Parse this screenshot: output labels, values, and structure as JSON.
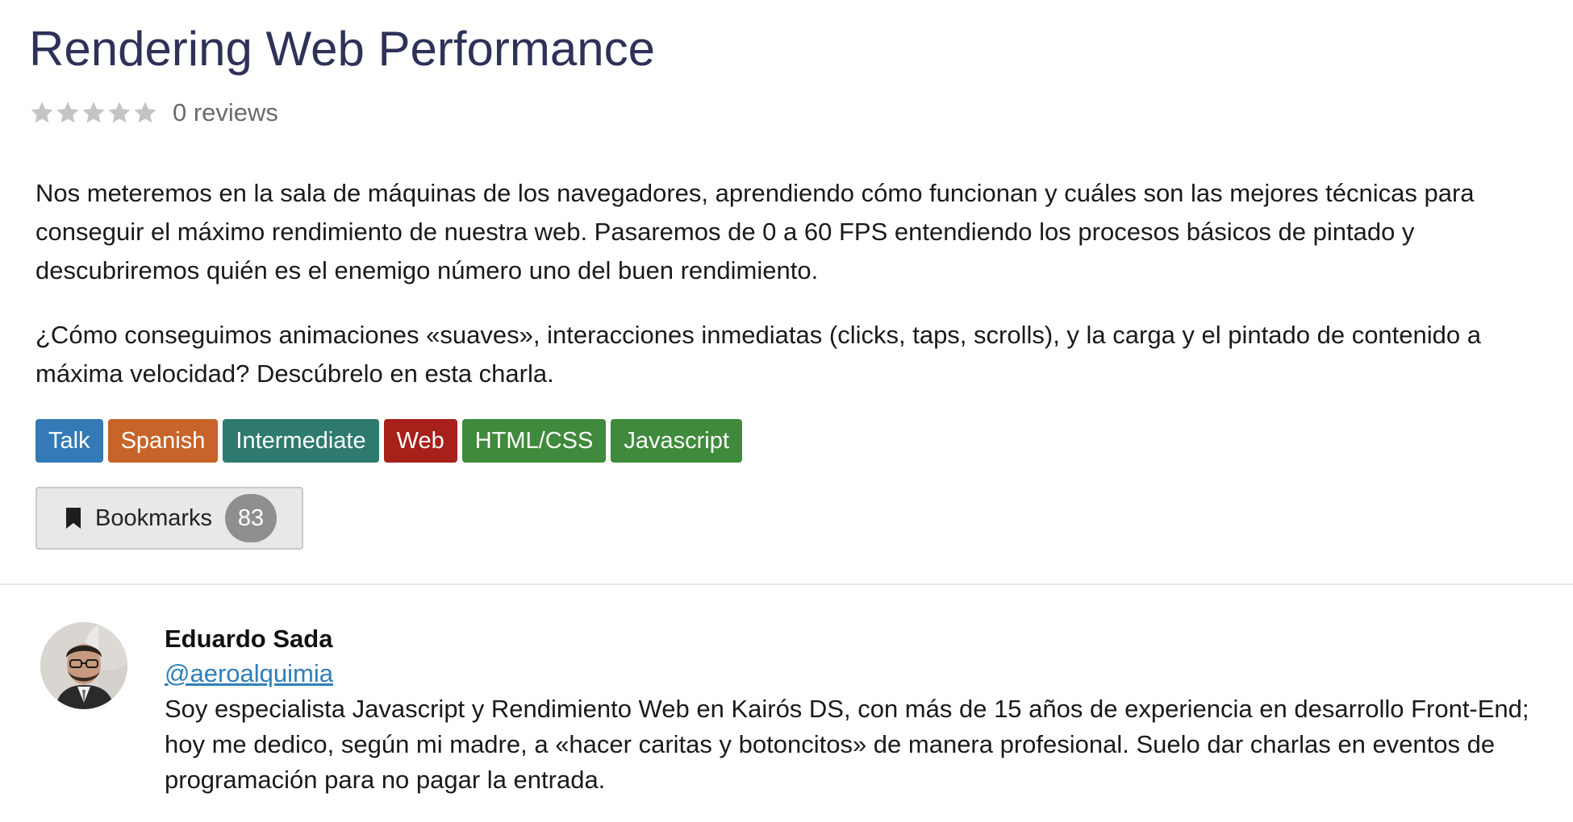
{
  "talk": {
    "title": "Rendering Web Performance",
    "rating": {
      "value": 0,
      "max": 5,
      "reviews_label": "0 reviews"
    },
    "description": [
      "Nos meteremos en la sala de máquinas de los navegadores, aprendiendo cómo funcionan y cuáles son las mejores técnicas para conseguir el máximo rendimiento de nuestra web. Pasaremos de 0 a 60 FPS entendiendo los procesos básicos de pintado y descubriremos quién es el enemigo número uno del buen rendimiento.",
      "¿Cómo conseguimos animaciones «suaves», interacciones inmediatas (clicks, taps, scrolls), y la carga y el pintado de contenido a máxima velocidad? Descúbrelo en esta charla."
    ],
    "tags": [
      {
        "label": "Talk",
        "color": "#337ab7"
      },
      {
        "label": "Spanish",
        "color": "#c8642a"
      },
      {
        "label": "Intermediate",
        "color": "#2f7a6e"
      },
      {
        "label": "Web",
        "color": "#a8201a"
      },
      {
        "label": "HTML/CSS",
        "color": "#3f8a3c"
      },
      {
        "label": "Javascript",
        "color": "#3f8a3c"
      }
    ],
    "bookmarks": {
      "label": "Bookmarks",
      "count": "83",
      "icon": "bookmark-icon"
    }
  },
  "speaker": {
    "name": "Eduardo Sada",
    "handle": "@aeroalquimia",
    "bio": "Soy especialista Javascript y Rendimiento Web en Kairós DS, con más de 15 años de experiencia en desarrollo Front-End; hoy me dedico, según mi madre, a «hacer caritas y botoncitos» de manera profesional. Suelo dar charlas en eventos de programación para no pagar la entrada."
  },
  "colors": {
    "title": "#2e3158",
    "star_empty": "#c4c4c4",
    "link": "#2e7fb8"
  }
}
